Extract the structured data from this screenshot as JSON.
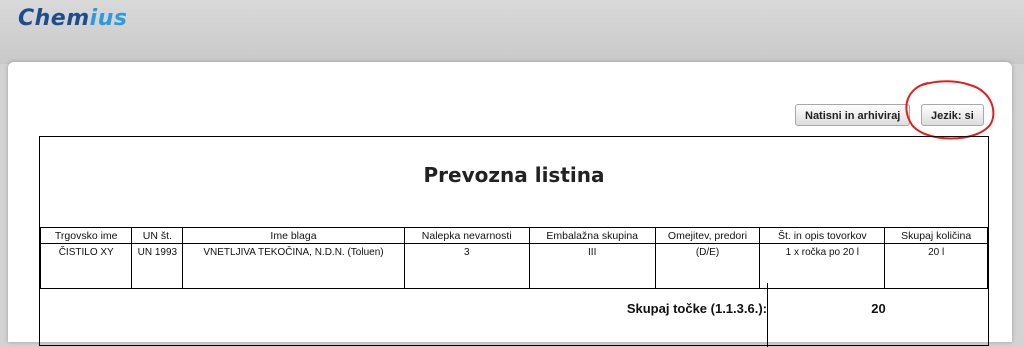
{
  "app": {
    "logo_part1": "Chem",
    "logo_part2": "ius"
  },
  "toolbar": {
    "print_archive_label": "Natisni in arhiviraj",
    "language_label": "Jezik: si"
  },
  "document": {
    "title": "Prevozna listina",
    "columns": [
      "Trgovsko ime",
      "UN št.",
      "Ime blaga",
      "Nalepka nevarnosti",
      "Embalažna skupina",
      "Omejitev, predori",
      "Št. in opis tovorkov",
      "Skupaj količina"
    ],
    "rows": [
      [
        "ČISTILO XY",
        "UN 1993",
        "VNETLJIVA TEKOČINA, N.D.N. (Toluen)",
        "3",
        "III",
        "(D/E)",
        "1 x ročka po 20 l",
        "20 l"
      ]
    ],
    "total_label": "Skupaj točke (1.1.3.6.):",
    "total_value": "20"
  },
  "annotation": {
    "circle_color": "#e0201c"
  }
}
